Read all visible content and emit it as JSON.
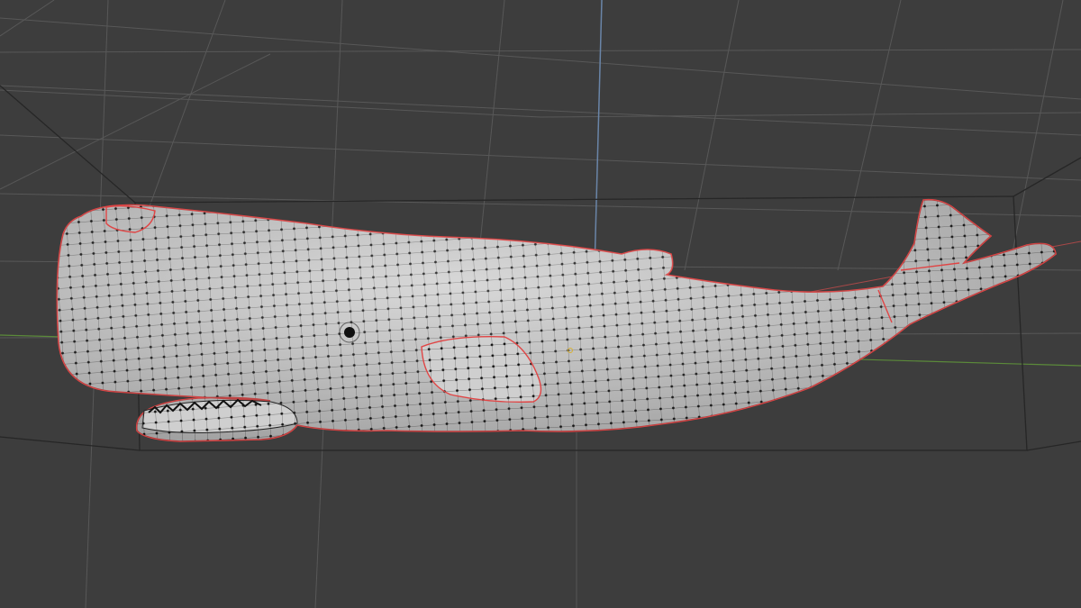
{
  "viewport": {
    "mode": "edit-mode",
    "object": "sperm-whale-mesh",
    "background_color": "#3d3d3d",
    "grid_color": "#5a5a5a",
    "bounding_box_color": "#2a2a2a",
    "mesh_color": "#cfcfcf",
    "vertex_color": "#111111",
    "seam_color": "#e04545",
    "x_axis_color": "#a84848",
    "y_axis_color": "#5b8a3a"
  }
}
